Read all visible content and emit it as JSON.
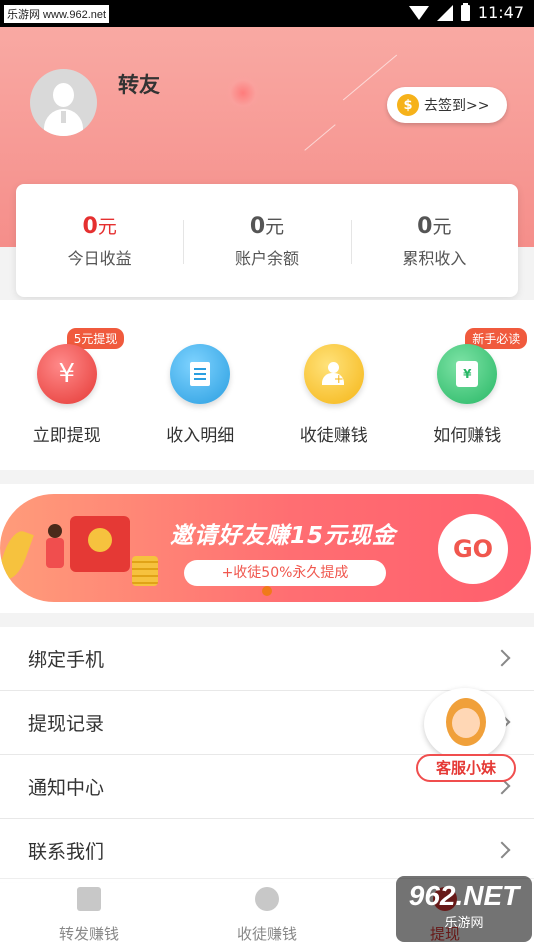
{
  "status_bar": {
    "watermark": "乐游网 www.962.net",
    "time": "11:47"
  },
  "profile": {
    "username": "转友",
    "checkin_label": "去签到>>",
    "checkin_icon": "coin-icon"
  },
  "stats": [
    {
      "value": "0",
      "unit": "元",
      "label": "今日收益"
    },
    {
      "value": "0",
      "unit": "元",
      "label": "账户余额"
    },
    {
      "value": "0",
      "unit": "元",
      "label": "累积收入"
    }
  ],
  "actions": [
    {
      "label": "立即提现",
      "badge": "5元提现",
      "icon": "yuan-icon",
      "color": "#e53935"
    },
    {
      "label": "收入明细",
      "badge": "",
      "icon": "document-icon",
      "color": "#2a9ee0"
    },
    {
      "label": "收徒赚钱",
      "badge": "",
      "icon": "add-user-icon",
      "color": "#f5b516"
    },
    {
      "label": "如何赚钱",
      "badge": "新手必读",
      "icon": "wallet-icon",
      "color": "#27b765"
    }
  ],
  "banner": {
    "title": "邀请好友赚15元现金",
    "subtitle": "+收徒50%永久提成",
    "go_label": "GO"
  },
  "menu": [
    {
      "label": "绑定手机"
    },
    {
      "label": "提现记录"
    },
    {
      "label": "通知中心"
    },
    {
      "label": "联系我们"
    }
  ],
  "customer_service": {
    "label": "客服小妹"
  },
  "tabbar": [
    {
      "label": "转发赚钱",
      "icon": "document-icon"
    },
    {
      "label": "收徒赚钱",
      "icon": "users-icon"
    },
    {
      "label": "提现",
      "icon": "profile-icon"
    }
  ],
  "site_logo": {
    "big": "962.NET",
    "small": "乐游网"
  },
  "colors": {
    "primary": "#e53935",
    "header": "#f8a09b"
  }
}
